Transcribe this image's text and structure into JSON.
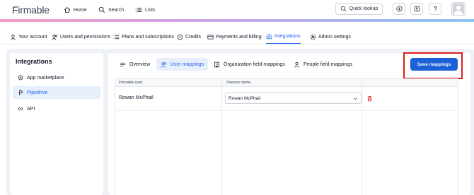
{
  "app": {
    "logo_text": "Firmable",
    "brand_color": "#2563eb",
    "danger_color": "#e11d1d"
  },
  "topnav": {
    "home": "Home",
    "search": "Search",
    "lists": "Lists",
    "quick_lookup": "Quick lookup"
  },
  "settings_tabs": [
    {
      "label": "Your account",
      "icon": "user-icon"
    },
    {
      "label": "Users and permissions",
      "icon": "users-icon"
    },
    {
      "label": "Plans and subscriptions",
      "icon": "list-icon"
    },
    {
      "label": "Credits",
      "icon": "credits-icon"
    },
    {
      "label": "Payments and billing",
      "icon": "card-icon"
    },
    {
      "label": "Integrations",
      "icon": "integrations-icon",
      "active": true
    },
    {
      "label": "Admin settings",
      "icon": "gear-icon"
    }
  ],
  "sidebar": {
    "title": "Integrations",
    "items": [
      {
        "label": "App marketplace",
        "icon": "marketplace-icon"
      },
      {
        "label": "Pipedrive",
        "icon": "pipedrive-icon",
        "active": true
      },
      {
        "label": "API",
        "icon": "code-icon"
      }
    ]
  },
  "main": {
    "tabs": [
      {
        "label": "Overview",
        "icon": "menu-icon"
      },
      {
        "label": "User mappings",
        "icon": "users-icon",
        "active": true
      },
      {
        "label": "Organization field mappings",
        "icon": "building-icon"
      },
      {
        "label": "People field mappings",
        "icon": "person-icon"
      }
    ],
    "save_label": "Save mappings",
    "table": {
      "columns": [
        "Firmable user",
        "Owners name"
      ],
      "rows": [
        {
          "firmable_user": "Rowan McPhail",
          "owner": "Rowan McPhail"
        }
      ]
    }
  }
}
